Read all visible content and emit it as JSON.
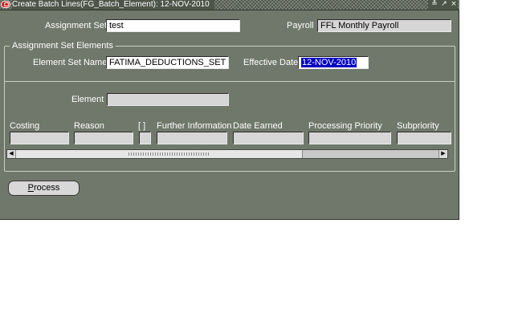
{
  "window": {
    "title": "Create Batch Lines(FG_Batch_Element): 12-NOV-2010",
    "controls": [
      "≚",
      "↗",
      "×"
    ]
  },
  "header": {
    "assignment_set_label": "Assignment Set",
    "assignment_set_value": "test",
    "payroll_label": "Payroll",
    "payroll_value": "FFL Monthly Payroll"
  },
  "elements_group": {
    "title": "Assignment Set Elements",
    "element_set_name_label": "Element Set Name",
    "element_set_name_value": "FATIMA_DEDUCTIONS_SET",
    "effective_date_label": "Effective Date",
    "effective_date_value": "12-NOV-2010",
    "element_label": "Element",
    "element_value": ""
  },
  "grid": {
    "columns": [
      {
        "label": "Costing"
      },
      {
        "label": "Reason"
      },
      {
        "label": "[ ]"
      },
      {
        "label": "Further Information"
      },
      {
        "label": "Date Earned"
      },
      {
        "label": "Processing Priority"
      },
      {
        "label": "Subpriority"
      }
    ],
    "row": [
      "",
      "",
      "",
      "",
      "",
      "",
      ""
    ]
  },
  "scrollbar": {
    "left_arrow": "◀",
    "right_arrow": "▶"
  },
  "actions": {
    "process_mnemonic": "P",
    "process_rest": "rocess"
  },
  "colors": {
    "form_background": "#6f786a",
    "title_bar": "#4d5549",
    "selection": "#0000c0",
    "readonly_field": "#d6d6d6"
  }
}
